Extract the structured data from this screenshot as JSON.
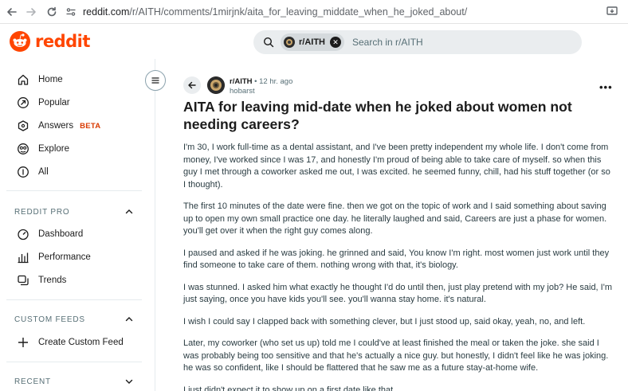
{
  "browser": {
    "url_host": "reddit.com",
    "url_path": "/r/AITH/comments/1mirjnk/aita_for_leaving_middate_when_he_joked_about/"
  },
  "header": {
    "logo_text": "reddit",
    "search_chip": "r/AITH",
    "search_placeholder": "Search in r/AITH",
    "accent_color": "#ff4500"
  },
  "sidebar": {
    "items": [
      {
        "label": "Home",
        "icon": "home-icon"
      },
      {
        "label": "Popular",
        "icon": "popular-icon"
      },
      {
        "label": "Answers",
        "icon": "answers-icon",
        "badge": "BETA"
      },
      {
        "label": "Explore",
        "icon": "explore-icon"
      },
      {
        "label": "All",
        "icon": "all-icon"
      }
    ],
    "pro_section": "REDDIT PRO",
    "pro_items": [
      {
        "label": "Dashboard",
        "icon": "dashboard-icon"
      },
      {
        "label": "Performance",
        "icon": "performance-icon"
      },
      {
        "label": "Trends",
        "icon": "trends-icon"
      }
    ],
    "custom_section": "CUSTOM FEEDS",
    "custom_items": [
      {
        "label": "Create Custom Feed",
        "icon": "plus-icon"
      }
    ],
    "recent_section": "RECENT"
  },
  "post": {
    "subreddit": "r/AITH",
    "time": "12 hr. ago",
    "author": "hobarst",
    "title": "AITA for leaving mid-date when he joked about women not needing careers?",
    "paragraphs": [
      "I'm 30, I work full-time as a dental assistant, and I've been pretty independent my whole life. I don't come from money, I've worked since I was 17, and honestly I'm proud of being able to take care of myself. so when this guy I met through a coworker asked me out, I was excited. he seemed funny, chill, had his stuff together (or so I thought).",
      "The first 10 minutes of the date were fine. then we got on the topic of work and I said something about saving up to open my own small practice one day. he literally laughed and said, Careers are just a phase for women. you'll get over it when the right guy comes along.",
      "I paused and asked if he was joking. he grinned and said, You know I'm right. most women just work until they find someone to take care of them. nothing wrong with that, it's biology.",
      "I was stunned. I asked him what exactly he thought I'd do until then, just play pretend with my job? He said, I'm just saying, once you have kids you'll see. you'll wanna stay home. it's natural.",
      "I wish I could say I clapped back with something clever, but I just stood up, said okay, yeah, no, and left.",
      "Later, my coworker (who set us up) told me I could've at least finished the meal or taken the joke. she said I was probably being too sensitive and that he's actually a nice guy. but honestly, I didn't feel like he was joking. he was so confident, like I should be flattered that he saw me as a future stay-at-home wife.",
      "I just didn't expect it to show up on a first date like that."
    ]
  }
}
